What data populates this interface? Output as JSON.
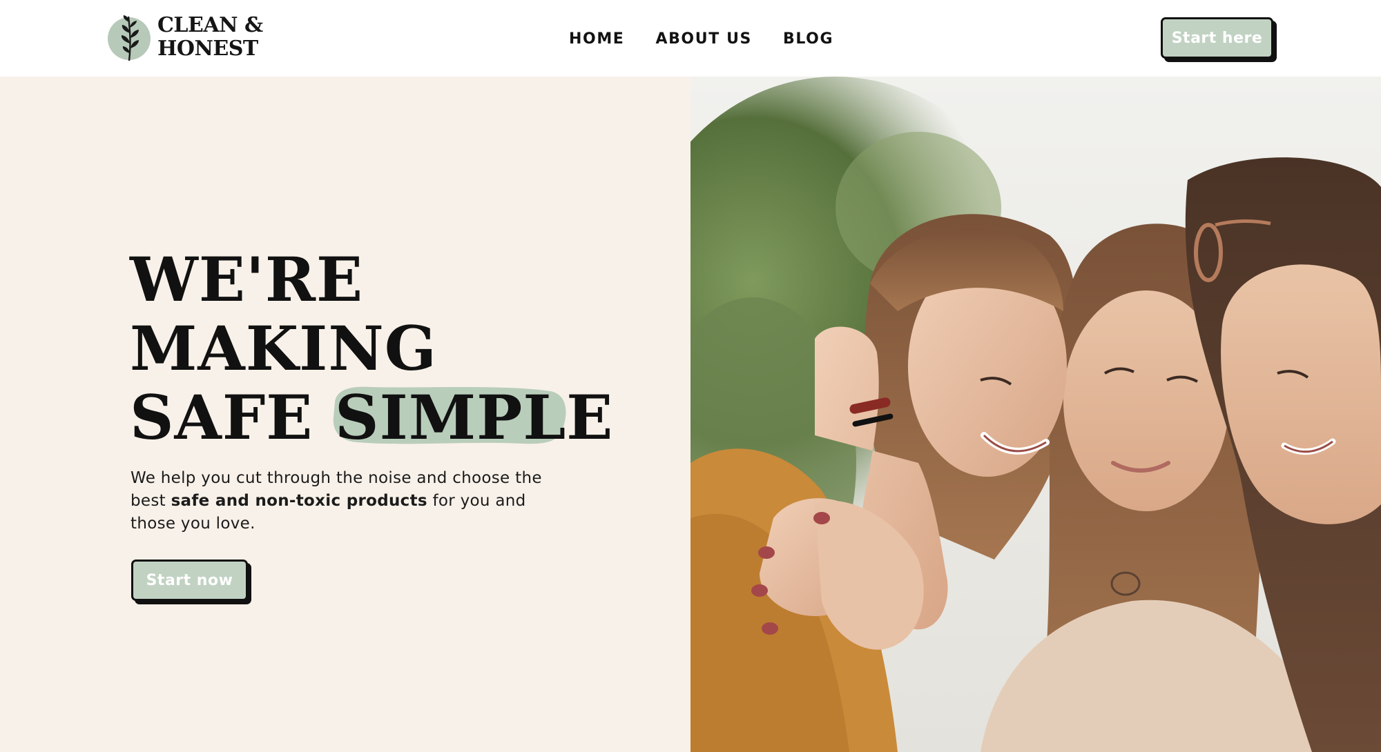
{
  "header": {
    "logo": {
      "line1": "CLEAN &",
      "line2": "HONEST"
    },
    "nav": [
      {
        "label": "HOME"
      },
      {
        "label": "ABOUT US"
      },
      {
        "label": "BLOG"
      }
    ],
    "cta_label": "Start here"
  },
  "hero": {
    "headline": {
      "line1": "WE'RE",
      "line2": "MAKING",
      "line3_plain": "SAFE",
      "line3_highlight": "SIMPLE"
    },
    "subtext": {
      "before": "We help you cut through the noise and choose the best ",
      "bold": "safe and non-toxic products",
      "after": " for you and those you love."
    },
    "cta_label": "Start now",
    "image_alt": "three-smiling-women-hugging-photo"
  },
  "colors": {
    "accent_sage": "#c1d2c3",
    "hero_bg_cream": "#f8f1e9",
    "text_dark": "#111111",
    "button_text": "#ffffff"
  },
  "icons": [
    "leaf-sprig-icon"
  ]
}
